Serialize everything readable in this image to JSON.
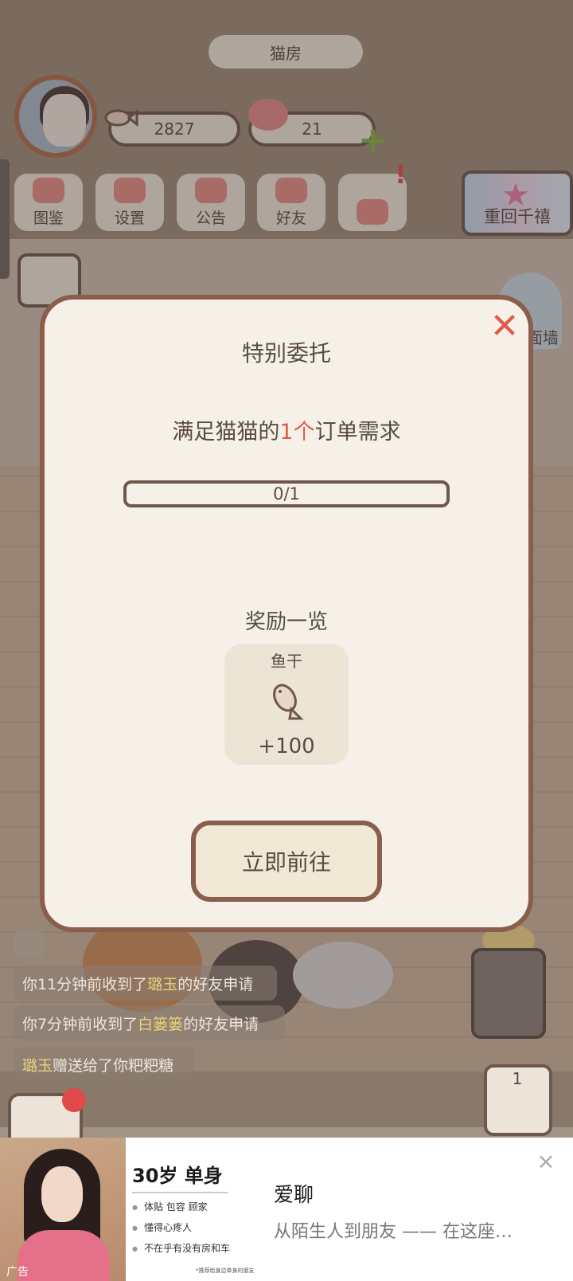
{
  "header": {
    "room_title": "猫房"
  },
  "currency": {
    "fish_count": "2827",
    "heart_count": "21"
  },
  "menu": {
    "items": [
      {
        "label": "图鉴"
      },
      {
        "label": "设置"
      },
      {
        "label": "公告"
      },
      {
        "label": "好友"
      },
      {
        "label": ""
      }
    ],
    "return_button": "重回千禧",
    "wall_label": "面墙"
  },
  "modal": {
    "title": "特别委托",
    "desc_prefix": "满足猫猫的",
    "desc_highlight": "1个",
    "desc_suffix": "订单需求",
    "progress_text": "0/1",
    "progress_fraction": 0,
    "reward_section_title": "奖励一览",
    "reward": {
      "name": "鱼干",
      "amount": "+100",
      "icon": "fish-icon"
    },
    "go_button": "立即前往",
    "close_icon": "close-icon"
  },
  "notifications": [
    {
      "prefix": "你11分钟前收到了",
      "name": "璐玉",
      "suffix": "的好友申请"
    },
    {
      "prefix": "你7分钟前收到了",
      "name": "白篓篓",
      "suffix": "的好友申请"
    },
    {
      "prefix": "",
      "name": "璐玉",
      "suffix": "赠送给了你粑粑糖"
    }
  ],
  "elevator": {
    "floor": "1"
  },
  "ad": {
    "headline": "30岁 单身",
    "bullets": [
      "体贴 包容 顾家",
      "懂得心疼人",
      "不在乎有没有房和车"
    ],
    "fine_print": "*推荐给身边单身的朋友",
    "app_name": "爱聊",
    "slogan": "从陌生人到朋友 —— 在这座…",
    "tag": "广告"
  },
  "colors": {
    "accent_red": "#e25a4a",
    "border_brown": "#8a5e4c",
    "panel_cream": "#f6f1e8"
  }
}
